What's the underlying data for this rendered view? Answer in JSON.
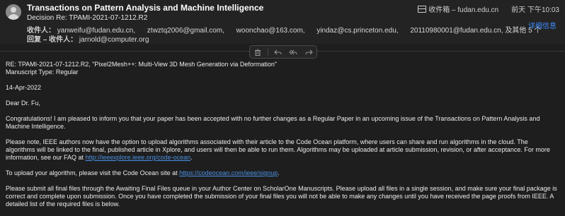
{
  "header": {
    "subject": "Transactions on Pattern Analysis and Machine Intelligence",
    "decision": "Decision Re: TPAMI-2021-07-1212.R2",
    "recipients_label": "收件人：",
    "recipients": [
      "yanweifu@fudan.edu.cn,",
      "ztwztq2006@gmail.com,",
      "woonchao@163.com,",
      "yindaz@cs.princeton.edu,",
      "20110980001@fudan.edu.cn,",
      "及其他 5 个"
    ],
    "reply_label": "回复 – 收件人：",
    "reply_to": "jarnold@computer.org",
    "mailbox": "收件箱 – fudan.edu.cn",
    "date": "前天 下午10:03",
    "details_link": "详细信息"
  },
  "toolbar": {
    "icons": [
      "trash-icon",
      "reply-icon",
      "reply-all-icon",
      "forward-icon"
    ]
  },
  "email": {
    "re_line": "RE: TPAMI-2021-07-1212.R2, \"Pixel2Mesh++: Multi-View 3D Mesh Generation via Deformation\"",
    "type_line": "Manuscript Type: Regular",
    "date": "14-Apr-2022",
    "greeting": "Dear Dr. Fu,",
    "para1": "Congratulations! I am pleased to inform you that your paper has been accepted with no further changes as a Regular Paper in an upcoming issue of the Transactions on Pattern Analysis and Machine Intelligence.",
    "para2_text": "Please note, IEEE authors now have the option to upload algorithms associated with their article to the Code Ocean platform, where users can share and run algorithms in the cloud. The algorithms will be linked to the final, published article in Xplore, and users will then be able to run them. Algorithms may be uploaded at article submission, revision, or after acceptance. For more information, see our FAQ at ",
    "para2_link": "http://ieeexplore.ieee.org/code-ocean",
    "para2_end": ".",
    "para3_text": "To upload your algorithm, please visit the Code Ocean site at ",
    "para3_link": "https://codeocean.com/ieee/signup",
    "para3_end": ".",
    "para4": "Please submit all final files through the Awaiting Final Files queue in your Author Center on ScholarOne Manuscripts. Please upload all files in a single session, and make sure your final package is correct and complete upon submission. Once you have completed the submission of your final files you will not be able to make any changes until you have received the page proofs from IEEE.  A detailed list of the required files is below."
  }
}
